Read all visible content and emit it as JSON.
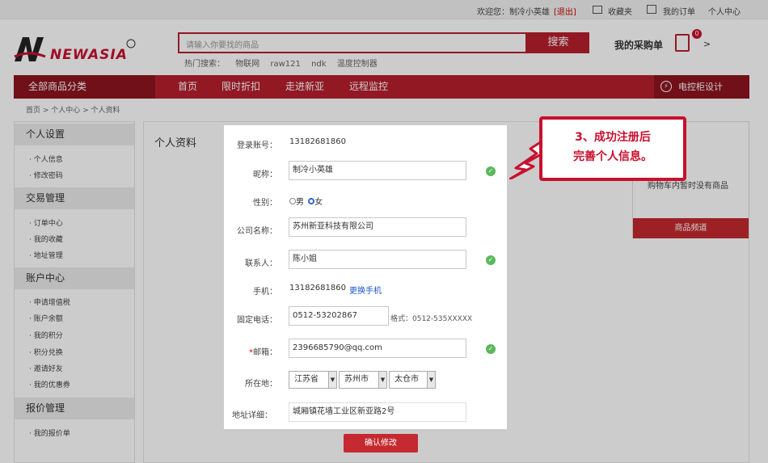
{
  "topbar": {
    "welcome": "欢迎您：制冷小英雄",
    "logout": "[退出]",
    "favorites": "收藏夹",
    "my_orders": "我的订单",
    "user_center": "个人中心"
  },
  "logo": {
    "brand": "NEWASIA"
  },
  "search": {
    "placeholder": "请输入你要找的商品",
    "button": "搜索",
    "hot_label": "热门搜索：",
    "hot_terms": [
      "物联网",
      "raw121",
      "ndk",
      "温度控制器"
    ]
  },
  "cart": {
    "label": "我的采购单",
    "count": "0"
  },
  "nav": {
    "all_categories": "全部商品分类",
    "items": [
      "首页",
      "限时折扣",
      "走进新亚",
      "远程监控"
    ],
    "cabinet_design": "电控柜设计"
  },
  "breadcrumb": "首页 > 个人中心 > 个人资料",
  "sidebar": {
    "sections": [
      {
        "title": "个人设置",
        "items": [
          "个人信息",
          "修改密码"
        ]
      },
      {
        "title": "交易管理",
        "items": [
          "订单中心",
          "我的收藏",
          "地址管理"
        ]
      },
      {
        "title": "账户中心",
        "items": [
          "申请增值税",
          "账户余额",
          "我的积分",
          "积分兑换",
          "邀请好友",
          "我的优惠券"
        ]
      },
      {
        "title": "报价管理",
        "items": [
          "我的报价单"
        ]
      }
    ]
  },
  "content": {
    "title": "个人资料"
  },
  "right_panel": {
    "text": "购物车内暂时没有商品",
    "button": "商品频道"
  },
  "form": {
    "account_label": "登录账号：",
    "account_value": "13182681860",
    "nickname_label": "昵称：",
    "nickname_value": "制冷小英雄",
    "gender_label": "性别：",
    "gender_male": "男",
    "gender_female": "女",
    "company_label": "公司名称：",
    "company_value": "苏州新亚科技有限公司",
    "contact_label": "联系人：",
    "contact_value": "陈小姐",
    "phone_label": "手机：",
    "phone_value": "13182681860",
    "change_phone": "更换手机",
    "landline_label": "固定电话：",
    "landline_value": "0512-53202867",
    "landline_hint": "格式：0512-535XXXXX",
    "email_label": "邮箱：",
    "email_value": "2396685790@qq.com",
    "location_label": "所在地：",
    "province": "江苏省",
    "city": "苏州市",
    "district": "太仓市",
    "address_label": "地址详细：",
    "address_value": "城厢镇花墙工业区新亚路2号",
    "submit": "确认修改"
  },
  "callout": {
    "line1": "3、成功注册后",
    "line2": "完善个人信息。"
  },
  "colors": {
    "brand_red": "#b7202e",
    "dark_red": "#8e1420",
    "ok_green": "#5cb85c"
  }
}
